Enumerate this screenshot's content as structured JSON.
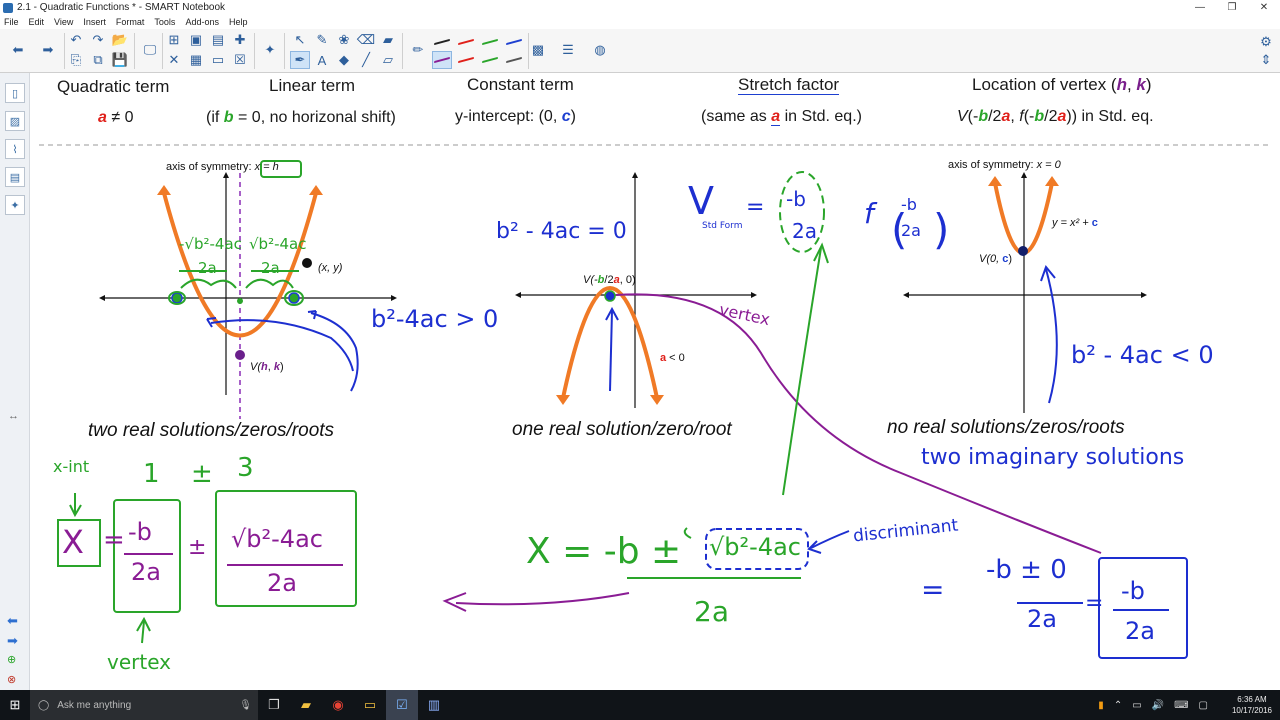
{
  "window": {
    "title": "2.1 - Quadratic Functions * - SMART Notebook"
  },
  "menu": [
    "File",
    "Edit",
    "View",
    "Insert",
    "Format",
    "Tools",
    "Add-ons",
    "Help"
  ],
  "headers": {
    "quadratic": "Quadratic term",
    "linear": "Linear term",
    "constant": "Constant term",
    "stretch": "Stretch factor",
    "vertex_loc_pre": "Location of vertex (",
    "vertex_loc_h": "h",
    "vertex_loc_comma": ", ",
    "vertex_loc_k": "k",
    "vertex_loc_post": ")"
  },
  "subheaders": {
    "quadratic_a": "a",
    "quadratic_rest": " ≠ 0",
    "linear_pre": "(if ",
    "linear_b": "b",
    "linear_post": " = 0, no horizonal shift)",
    "constant_pre": "y-intercept: (0, ",
    "constant_c": "c",
    "constant_post": ")",
    "stretch_pre": "(same as ",
    "stretch_a": "a",
    "stretch_post": " in Std. eq.)",
    "vertex_V": "V",
    "vertex_p1": "(-",
    "vertex_b1": "b",
    "vertex_p2": "/2",
    "vertex_a1": "a",
    "vertex_p3": ", ",
    "vertex_f": "f",
    "vertex_p4": "(-",
    "vertex_b2": "b",
    "vertex_p5": "/2",
    "vertex_a2": "a",
    "vertex_p6": ")) in Std. eq."
  },
  "graph1": {
    "axis_label": "axis of symmetry: ",
    "axis_value": "x = h",
    "point_label": "(x, y)",
    "vertex_label_V": "V(",
    "vertex_label_h": "h",
    "vertex_label_comma": ", ",
    "vertex_label_k": "k",
    "vertex_label_close": ")",
    "caption": "two real solutions/zeros/roots",
    "hw_disc": "b²-4ac > 0",
    "hw_left_num": "-√b²-4ac",
    "hw_left_den": "2a",
    "hw_right_num": "√b²-4ac",
    "hw_right_den": "2a"
  },
  "graph2": {
    "vertex_pre": "V(-",
    "vertex_b": "b",
    "vertex_mid": "/2",
    "vertex_a": "a",
    "vertex_post": ", 0)",
    "a_label_a": "a",
    "a_label_rest": " < 0",
    "caption": "one real solution/zero/root",
    "hw_disc": "b² - 4ac = 0",
    "hw_vertex": "vertex",
    "hw_vstd": "V",
    "hw_vstd_sub": "Std Form",
    "hw_eq": "=",
    "hw_neg_b": "-b",
    "hw_2a": "2a",
    "hw_f": "f"
  },
  "graph3": {
    "axis_label": "axis of symmetry: ",
    "axis_value": "x = 0",
    "eq_pre": "y = x² + ",
    "eq_c": "c",
    "vertex_pre": "V(0, ",
    "vertex_c": "c",
    "vertex_post": ")",
    "caption": "no real solutions/zeros/roots",
    "hw_sub": "two imaginary solutions",
    "hw_disc": "b² - 4ac < 0"
  },
  "bottom": {
    "xint": "x-int",
    "one": "1",
    "pm": "±",
    "three": "3",
    "x": "X",
    "eq": "=",
    "neg_b": "-b",
    "two_a": "2a",
    "plus_minus": "±",
    "sqrt_num": "√b²-4ac",
    "sqrt_den": "2a",
    "vertex": "vertex",
    "formula_x": "X = -b ±",
    "formula_disc": "√b²-4ac",
    "formula_den": "2a",
    "discriminant": "discriminant",
    "zero_num": "-b ± 0",
    "zero_den": "2a",
    "zero_eq": "=",
    "eq2": "=",
    "final_num": "-b",
    "final_den": "2a"
  },
  "taskbar": {
    "search": "Ask me anything",
    "time": "6:36 AM",
    "date": "10/17/2016"
  },
  "colors": {
    "parabola": "#f07a26",
    "axis_sym": "#8a2bb5",
    "hw_blue": "#1d2fd0",
    "hw_green": "#2aa52a",
    "hw_purple": "#8a1c94"
  }
}
